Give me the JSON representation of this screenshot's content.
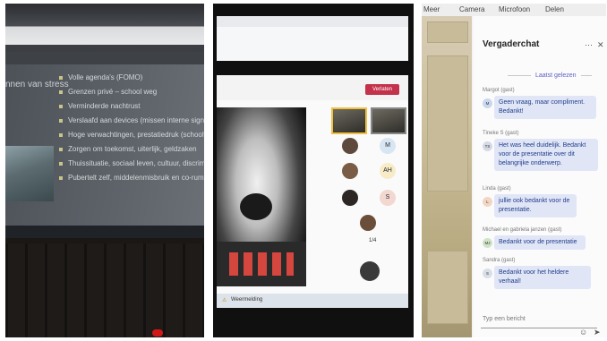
{
  "panel1": {
    "slide_title": "nnen van stress",
    "bullets": [
      "Volle agenda's (FOMO)",
      "Grenzen privé – school weg",
      "Verminderde nachtrust",
      "Verslaafd aan devices (missen interne signalen)",
      "Hoge verwachtingen, prestatiedruk (schoolwerk",
      "Zorgen om toekomst, uiterlijk, geldzaken",
      "Thuissituatie, sociaal leven, cultuur, discrimina",
      "Pubertelt zelf, middelenmisbruik en co-rumina"
    ]
  },
  "panel2": {
    "leave_label": "Verlaten",
    "participants": [
      "M",
      "AH",
      "S"
    ],
    "page_indicator": "1/4",
    "taskbar_weather": "Weermelding"
  },
  "panel3": {
    "top_tabs": [
      "Meer",
      "Camera",
      "Microfoon",
      "Delen"
    ],
    "title": "Vergaderchat",
    "divider": "Laatst gelezen",
    "messages": [
      {
        "sender": "Margot (gast)",
        "initials": "M",
        "text": "Geen vraag, maar compliment. Bedankt!"
      },
      {
        "sender": "Tineke S (gast)",
        "initials": "TS",
        "text": "Het was heel duidelijk. Bedankt voor de presentatie over dit belangrijke onderwerp."
      },
      {
        "sender": "Linda (gast)",
        "initials": "L",
        "text": "jullie ook bedankt voor de presentatie."
      },
      {
        "sender": "Michael en gabriela janzen (gast)",
        "initials": "MJ",
        "text": "Bedankt voor de presentatie"
      },
      {
        "sender": "Sandra (gast)",
        "initials": "S",
        "text": "Bedankt voor het heldere verhaal!"
      }
    ],
    "composer_placeholder": "Typ een bericht"
  }
}
